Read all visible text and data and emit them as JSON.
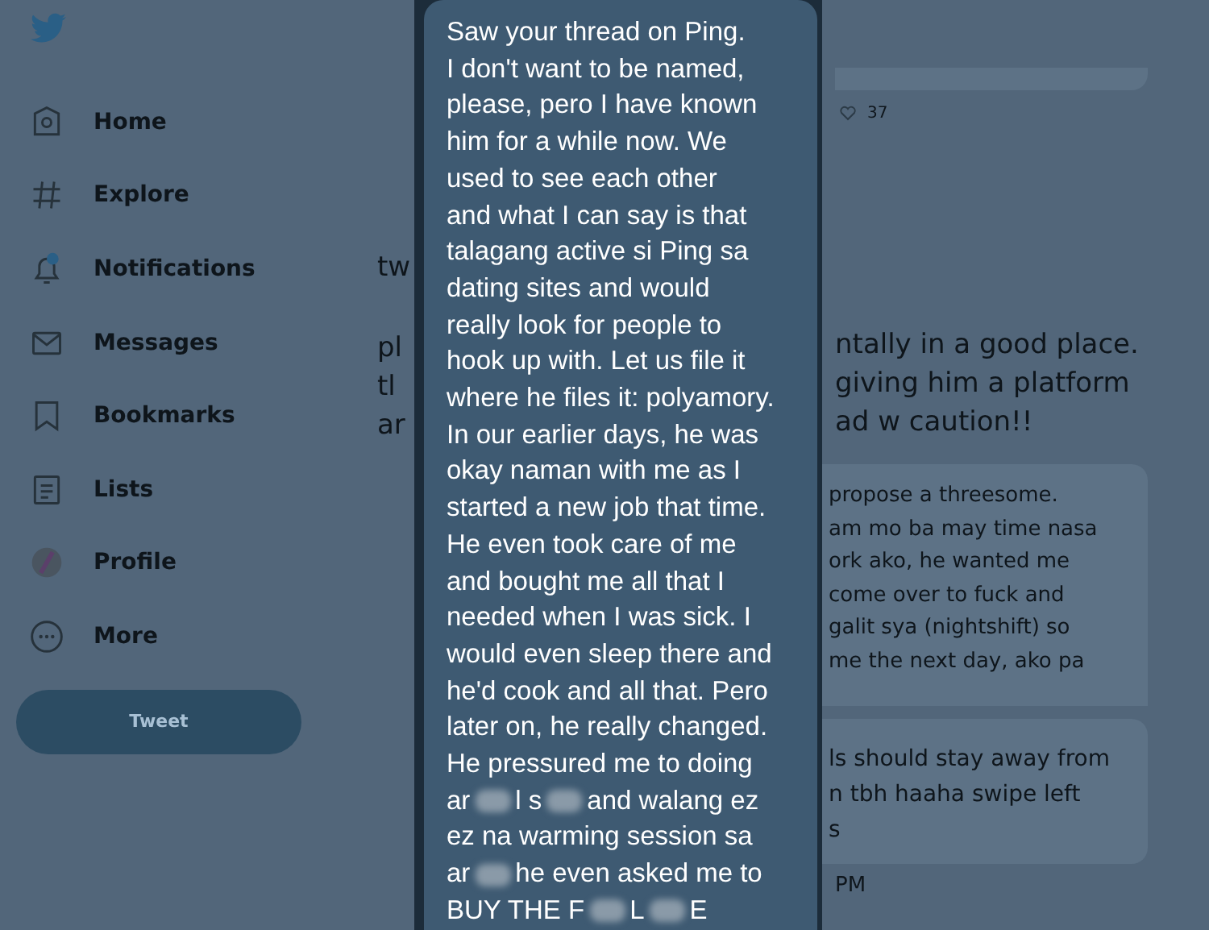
{
  "sidebar": {
    "items": [
      {
        "label": "Home"
      },
      {
        "label": "Explore"
      },
      {
        "label": "Notifications"
      },
      {
        "label": "Messages"
      },
      {
        "label": "Bookmarks"
      },
      {
        "label": "Lists"
      },
      {
        "label": "Profile"
      },
      {
        "label": "More"
      }
    ],
    "tweet_button": "Tweet"
  },
  "background": {
    "left_fragments": [
      "tw",
      "pl",
      "tl",
      "ar"
    ],
    "like_count": "37",
    "tweet_lines": [
      "ntally in a good place.",
      "giving him a platform",
      "ad w caution!!"
    ],
    "card_1_lines": [
      "propose a threesome.",
      "am mo ba may time nasa",
      "ork ako, he wanted me",
      "come over to fuck and",
      "galit sya (nightshift) so",
      "me the next day, ako pa"
    ],
    "card_2_lines": [
      "ls should stay away from",
      "n tbh haaha swipe left",
      "s"
    ],
    "timestamp": "PM"
  },
  "message": {
    "lines": [
      {
        "parts": [
          {
            "kind": "text",
            "text": "Saw your thread on Ping."
          }
        ]
      },
      {
        "parts": [
          {
            "kind": "text",
            "text": "I don't want to be named,"
          }
        ]
      },
      {
        "parts": [
          {
            "kind": "text",
            "text": "please, pero I have known"
          }
        ]
      },
      {
        "parts": [
          {
            "kind": "text",
            "text": "him for a while now. We"
          }
        ]
      },
      {
        "parts": [
          {
            "kind": "text",
            "text": "used to see each other"
          }
        ]
      },
      {
        "parts": [
          {
            "kind": "text",
            "text": "and what I can say is that"
          }
        ]
      },
      {
        "parts": [
          {
            "kind": "text",
            "text": "talagang active si Ping sa"
          }
        ]
      },
      {
        "parts": [
          {
            "kind": "text",
            "text": "dating sites and would"
          }
        ]
      },
      {
        "parts": [
          {
            "kind": "text",
            "text": "really look for people to"
          }
        ]
      },
      {
        "parts": [
          {
            "kind": "text",
            "text": "hook up with. Let us file it"
          }
        ]
      },
      {
        "parts": [
          {
            "kind": "text",
            "text": "where he files it: polyamory."
          }
        ]
      },
      {
        "parts": [
          {
            "kind": "text",
            "text": "In our earlier days, he was"
          }
        ]
      },
      {
        "parts": [
          {
            "kind": "text",
            "text": "okay naman with me as I"
          }
        ]
      },
      {
        "parts": [
          {
            "kind": "text",
            "text": "started a new job that time."
          }
        ]
      },
      {
        "parts": [
          {
            "kind": "text",
            "text": "He even took care of me"
          }
        ]
      },
      {
        "parts": [
          {
            "kind": "text",
            "text": "and bought me all that I"
          }
        ]
      },
      {
        "parts": [
          {
            "kind": "text",
            "text": "needed when I was sick. I"
          }
        ]
      },
      {
        "parts": [
          {
            "kind": "text",
            "text": "would even sleep there and"
          }
        ]
      },
      {
        "parts": [
          {
            "kind": "text",
            "text": "he'd cook and all that. Pero"
          }
        ]
      },
      {
        "parts": [
          {
            "kind": "text",
            "text": "later on, he really changed."
          }
        ]
      },
      {
        "parts": [
          {
            "kind": "text",
            "text": "He pressured me to doing"
          }
        ]
      },
      {
        "parts": [
          {
            "kind": "text",
            "text": "ar"
          },
          {
            "kind": "blur"
          },
          {
            "kind": "text",
            "text": "l s"
          },
          {
            "kind": "blur"
          },
          {
            "kind": "text",
            "text": "and walang ez"
          }
        ]
      },
      {
        "parts": [
          {
            "kind": "text",
            "text": "ez na warming session sa"
          }
        ]
      },
      {
        "parts": [
          {
            "kind": "text",
            "text": "ar"
          },
          {
            "kind": "blur"
          },
          {
            "kind": "text",
            "text": "he even asked me to"
          }
        ]
      },
      {
        "parts": [
          {
            "kind": "text",
            "text": "BUY THE F"
          },
          {
            "kind": "blur"
          },
          {
            "kind": "text",
            "text": "L"
          },
          {
            "kind": "blur"
          },
          {
            "kind": "text",
            "text": "E"
          }
        ]
      }
    ]
  }
}
